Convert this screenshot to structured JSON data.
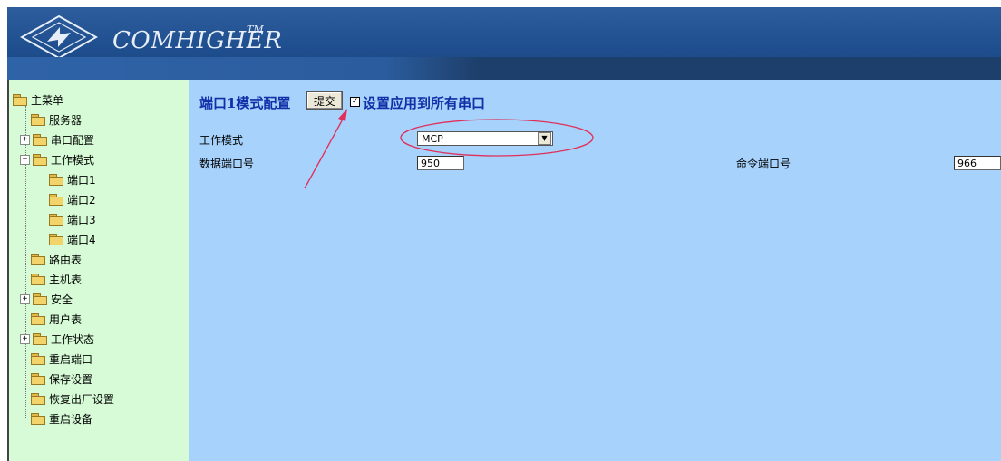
{
  "header": {
    "brand": "COMHIGHER",
    "trademark": "TM"
  },
  "sidebar": {
    "root": "主菜单",
    "items": [
      {
        "label": "服务器"
      },
      {
        "label": "串口配置"
      },
      {
        "label": "工作模式"
      },
      {
        "label": "端口1"
      },
      {
        "label": "端口2"
      },
      {
        "label": "端口3"
      },
      {
        "label": "端口4"
      },
      {
        "label": "路由表"
      },
      {
        "label": "主机表"
      },
      {
        "label": "安全"
      },
      {
        "label": "用户表"
      },
      {
        "label": "工作状态"
      },
      {
        "label": "重启端口"
      },
      {
        "label": "保存设置"
      },
      {
        "label": "恢复出厂设置"
      },
      {
        "label": "重启设备"
      }
    ]
  },
  "main": {
    "title": "端口1模式配置",
    "submit_label": "提交",
    "apply_all_checked": true,
    "apply_all_label": "设置应用到所有串口",
    "work_mode_label": "工作模式",
    "work_mode_value": "MCP",
    "data_port_label": "数据端口号",
    "data_port_value": "950",
    "command_port_label": "命令端口号",
    "command_port_value": "966"
  },
  "annotation": {
    "color": "#e0305a"
  }
}
